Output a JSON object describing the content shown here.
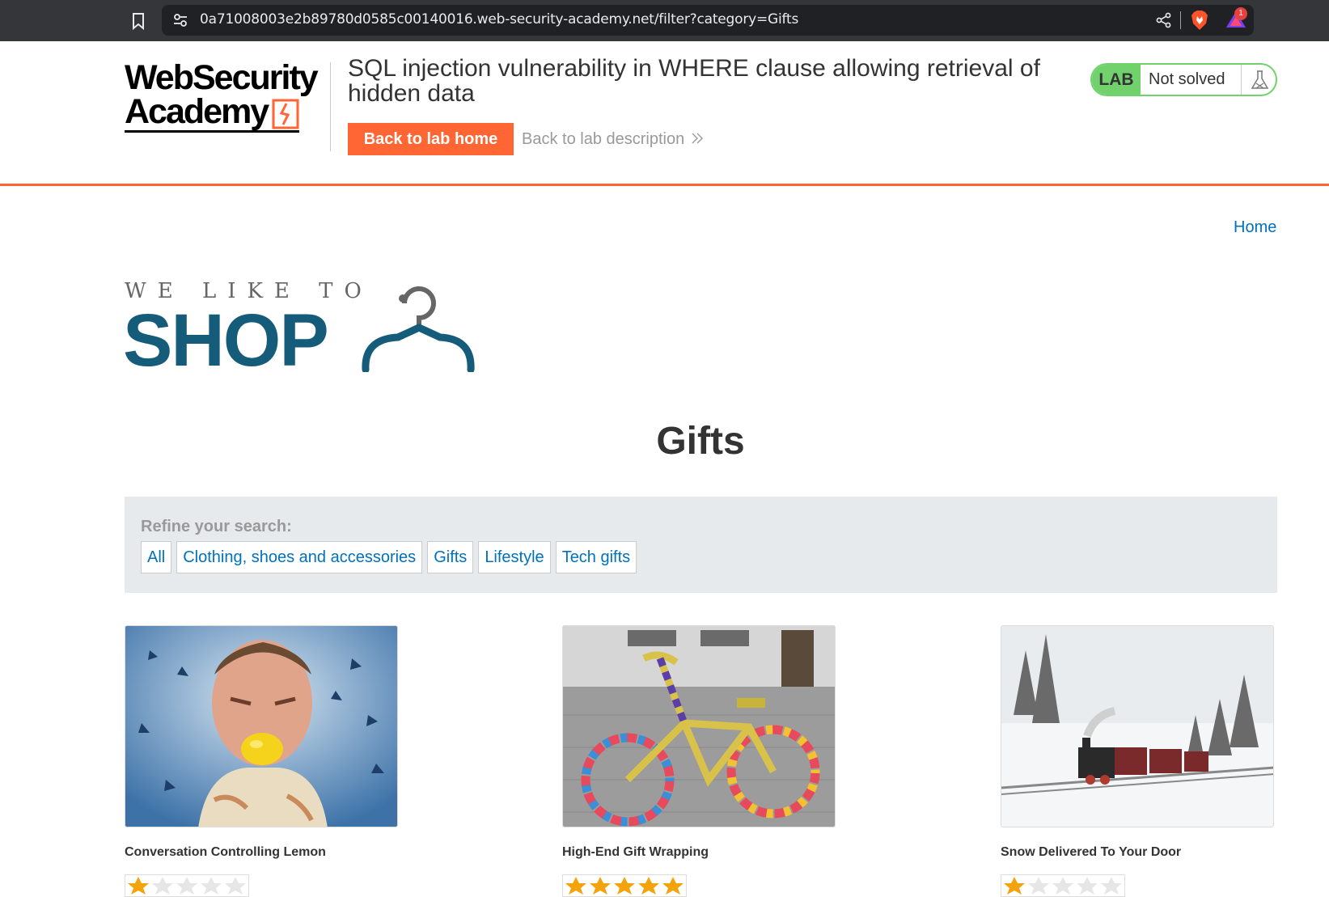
{
  "browser": {
    "url": "0a71008003e2b89780d0585c00140016.web-security-academy.net/filter?category=Gifts",
    "rewards_badge": "1"
  },
  "academy": {
    "logo_line1": "WebSecurity",
    "logo_line2": "Academy",
    "lab_title": "SQL injection vulnerability in WHERE clause allowing retrieval of hidden data",
    "back_to_lab_home": "Back to lab home",
    "back_to_lab_description": "Back to lab description",
    "status_tag": "LAB",
    "status_text": "Not solved"
  },
  "shop": {
    "home_link": "Home",
    "brand_tagline": "WE LIKE TO",
    "brand_name": "SHOP",
    "category_title": "Gifts",
    "refine_label": "Refine your search:",
    "filters": [
      "All",
      "Clothing, shoes and accessories",
      "Gifts",
      "Lifestyle",
      "Tech gifts"
    ],
    "products": [
      {
        "name": "Conversation Controlling Lemon",
        "rating": 1,
        "image": "lemon-photo"
      },
      {
        "name": "High-End Gift Wrapping",
        "rating": 5,
        "image": "knitted-bicycle-photo"
      },
      {
        "name": "Snow Delivered To Your Door",
        "rating": 1,
        "image": "snow-train-photo"
      }
    ]
  },
  "colors": {
    "accent_orange": "#ff6633",
    "link_blue": "#0071bc",
    "status_green": "#70d16d",
    "shop_blue": "#155b7a",
    "star_gold": "#f5a30a"
  }
}
